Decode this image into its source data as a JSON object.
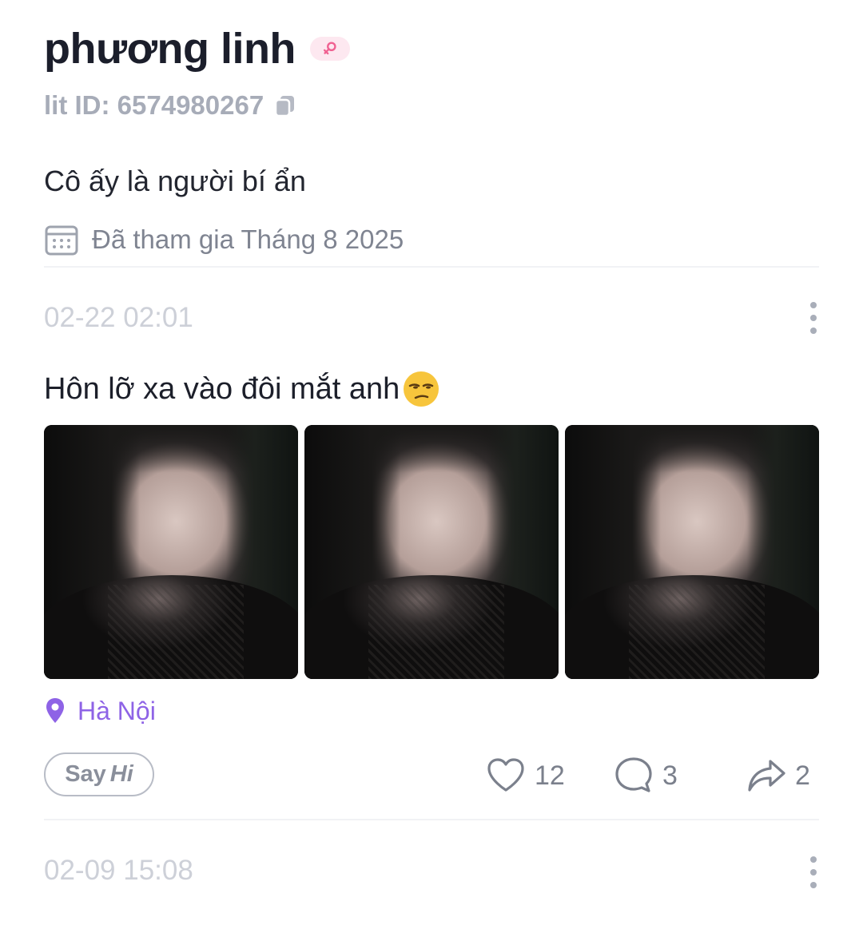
{
  "profile": {
    "name": "phương linh",
    "gender_badge_icon": "female-icon",
    "lit_id": "lit ID: 6574980267",
    "bio": "Cô ấy là người bí ẩn",
    "joined": "Đã tham gia Tháng 8 2025"
  },
  "posts": [
    {
      "time": "02-22 02:01",
      "text": "Hôn lỡ xa vào đôi mắt anh",
      "emoji": "unamused-face-emoji",
      "photos": [
        "photo-1",
        "photo-2",
        "photo-3"
      ],
      "location": "Hà Nội",
      "say_hi": {
        "say": "Say",
        "hi": "Hi"
      },
      "likes": "12",
      "comments": "3",
      "shares": "2"
    },
    {
      "time": "02-09 15:08"
    }
  ],
  "colors": {
    "accent_location": "#8e63e6",
    "badge_pink": "#f06292",
    "muted_text": "#a7acb8"
  }
}
